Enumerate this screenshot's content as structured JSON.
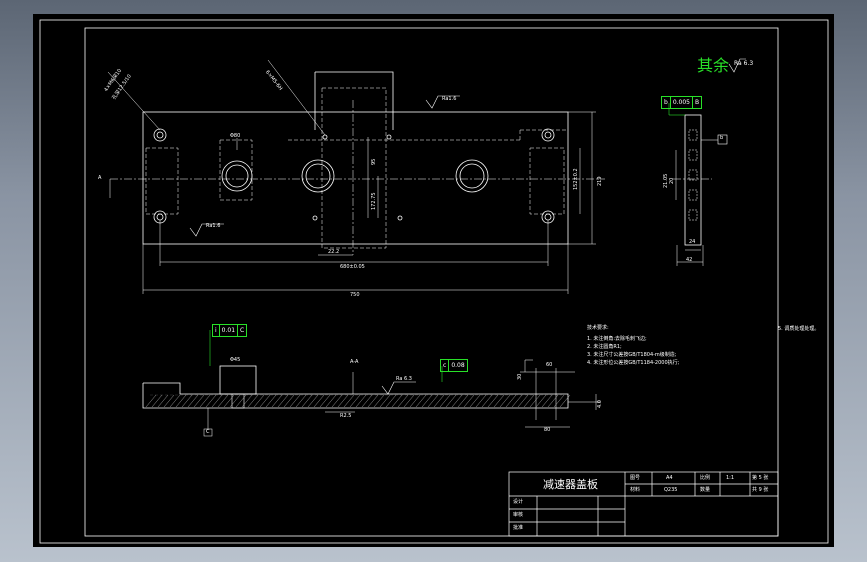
{
  "drawing": {
    "roughness_general": "其余",
    "roughness_general_value": "Ra 6.3",
    "tech_requirements": {
      "heading": "技术要求:",
      "items": [
        "1. 未注倒角:去除毛刺飞边;",
        "2. 未注圆角R1;",
        "3. 未注尺寸公差按GB/T1804-m级制造;",
        "4. 未注形位公差按GB/T1184-2000执行;"
      ],
      "side_note": "5. 调质处理处理。"
    },
    "plan_dims": {
      "overall_length": "750",
      "hole_spacing": "680±0.05",
      "offset": "22.2",
      "width_right": "219",
      "depth": "42",
      "side_small": "24",
      "center_h": "95",
      "center_h2": "172.75",
      "pocket": "152±0.2"
    },
    "plan_labels": {
      "hole_note_1": "4×M6深10",
      "hole_note_2": "孔深12.5/10",
      "hole_note_3": "6×M5-6H",
      "bore": "Φ80",
      "roughness_top": "Ra1.6",
      "roughness_bottom": "Ra1.6",
      "side_dim": "21.05",
      "side_dim2": "20",
      "datum_b": "b",
      "arrow_a": "A"
    },
    "tolerance_frames": {
      "parallel": {
        "symbol": "b",
        "value": "0.005",
        "datum": "B"
      },
      "flatness": {
        "symbol": "i",
        "value": "0.01",
        "datum": "C"
      },
      "section": {
        "symbol": "c",
        "value": "0.08"
      }
    },
    "section_labels": {
      "label_a": "A-A",
      "roughness": "Ra 6.3",
      "dim_60": "60",
      "dim_80": "80",
      "dim_30": "30",
      "dim_4": "4.0",
      "dim_r": "R2.5",
      "dim_left": "Φ45",
      "datum_left": "C"
    },
    "title_block": {
      "part_name": "减速器盖板",
      "drawing_no_label": "图号",
      "drawing_no": "A4",
      "material_label": "材料",
      "material": "Q235",
      "scale_label": "比例",
      "scale": "1:1",
      "weight_label": "数量",
      "sheet": "第 5 张",
      "total": "共 9 张",
      "design": "设计",
      "review": "审核",
      "approve": "批准"
    }
  }
}
